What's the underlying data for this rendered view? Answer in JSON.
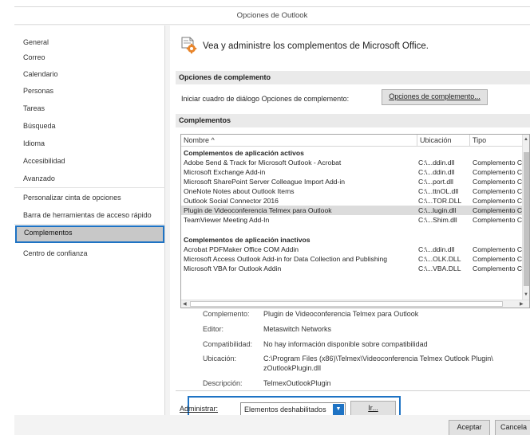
{
  "window": {
    "title": "Opciones de Outlook"
  },
  "nav": {
    "items": [
      {
        "label": "General"
      },
      {
        "label": "Correo"
      },
      {
        "label": "Calendario"
      },
      {
        "label": "Personas"
      },
      {
        "label": "Tareas"
      },
      {
        "label": "Búsqueda"
      },
      {
        "label": "Idioma"
      },
      {
        "label": "Accesibilidad"
      },
      {
        "label": "Avanzado"
      },
      {
        "label": "Personalizar cinta de opciones"
      },
      {
        "label": "Barra de herramientas de acceso rápido"
      },
      {
        "label": "Complementos",
        "selected": true
      },
      {
        "label": "Centro de confianza"
      }
    ]
  },
  "main": {
    "hero_text": "Vea y administre los complementos de Microsoft Office.",
    "hero_icon": "addin-gear-icon",
    "options_section": {
      "title": "Opciones de complemento",
      "label": "Iniciar cuadro de diálogo Opciones de complemento:",
      "button_label": "Opciones de complemento..."
    },
    "addins_section": {
      "title": "Complementos",
      "columns": [
        "Nombre ^",
        "Ubicación",
        "Tipo"
      ],
      "active_group": "Complementos de aplicación activos",
      "active": [
        {
          "name": "Adobe Send & Track for Microsoft Outlook - Acrobat",
          "location": "C:\\...ddin.dll",
          "type": "Complemento C"
        },
        {
          "name": "Microsoft Exchange Add-in",
          "location": "C:\\...ddin.dll",
          "type": "Complemento C"
        },
        {
          "name": "Microsoft SharePoint Server Colleague Import Add-in",
          "location": "C:\\...port.dll",
          "type": "Complemento C"
        },
        {
          "name": "OneNote Notes about Outlook Items",
          "location": "C:\\...ttnOL.dll",
          "type": "Complemento C"
        },
        {
          "name": "Outlook Social Connector 2016",
          "location": "C:\\...TOR.DLL",
          "type": "Complemento C"
        },
        {
          "name": "Plugin de Videoconferencia Telmex para Outlook",
          "location": "C:\\...lugin.dll",
          "type": "Complemento C",
          "selected": true
        },
        {
          "name": "TeamViewer Meeting Add-In",
          "location": "C:\\...Shim.dll",
          "type": "Complemento C"
        }
      ],
      "inactive_group": "Complementos de aplicación inactivos",
      "inactive": [
        {
          "name": "Acrobat PDFMaker Office COM Addin",
          "location": "C:\\...ddin.dll",
          "type": "Complemento C"
        },
        {
          "name": "Microsoft Access Outlook Add-in for Data Collection and Publishing",
          "location": "C:\\...OLK.DLL",
          "type": "Complemento C"
        },
        {
          "name": "Microsoft VBA for Outlook Addin",
          "location": "C:\\...VBA.DLL",
          "type": "Complemento C"
        }
      ]
    },
    "details": {
      "addin_label": "Complemento:",
      "addin_value": "Plugin de Videoconferencia Telmex para Outlook",
      "publisher_label": "Editor:",
      "publisher_value": "Metaswitch Networks",
      "compat_label": "Compatibilidad:",
      "compat_value": "No hay información disponible sobre compatibilidad",
      "location_label": "Ubicación:",
      "location_value_1": "C:\\Program Files (x86)\\Telmex\\Videoconferencia Telmex Outlook Plugin\\",
      "location_value_2": "zOutlookPlugin.dll",
      "desc_label": "Descripción:",
      "desc_value": "TelmexOutlookPlugin"
    },
    "manage": {
      "label": "Administrar:",
      "selected": "Elementos deshabilitados",
      "go_label": "Ir..."
    }
  },
  "footer": {
    "ok_label": "Aceptar",
    "cancel_label": "Cancela"
  },
  "colors": {
    "accent": "#1e73c4",
    "selection": "#dcdcdc",
    "nav_selected": "#c8c8c8"
  }
}
